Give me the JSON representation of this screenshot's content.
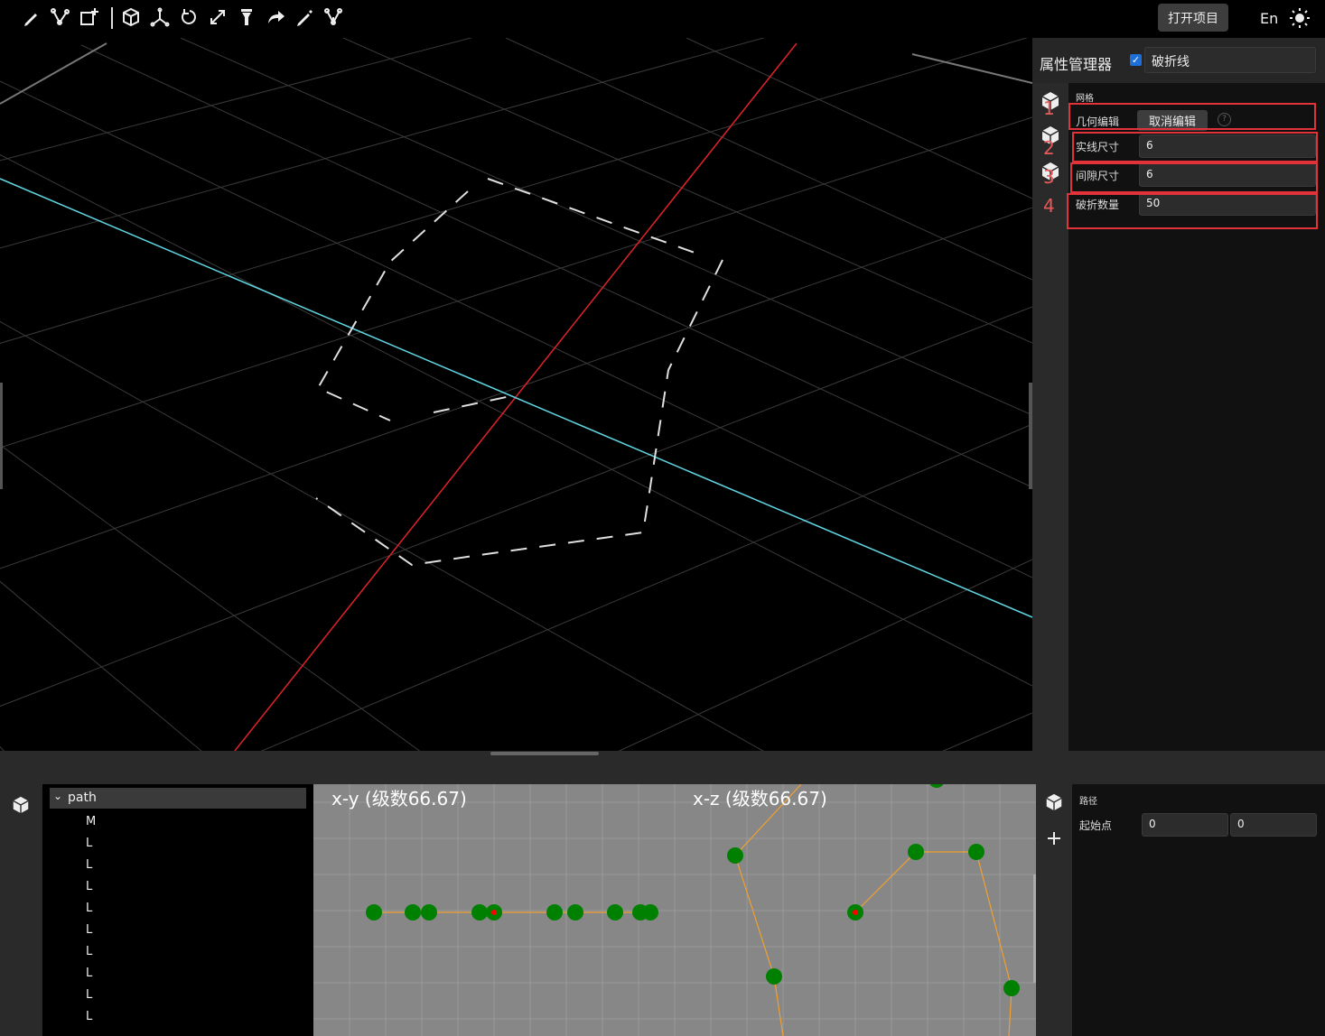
{
  "toolbar": {
    "tools": [
      "pencil-icon",
      "polyline-icon",
      "add-shape-icon",
      "cube-icon",
      "axes-icon",
      "rotate-icon",
      "scale-icon",
      "flashlight-icon",
      "redo-icon",
      "edit-icon",
      "branch-icon"
    ],
    "open_project": "打开项目",
    "language": "En",
    "theme_icon": "sun-icon"
  },
  "properties": {
    "title": "属性管理器",
    "enabled": true,
    "object_name": "破折线",
    "group": "网格",
    "geometry_edit_label": "几何编辑",
    "cancel_edit": "取消编辑",
    "help": "?",
    "dash_size_label": "实线尺寸",
    "dash_size": "6",
    "gap_size_label": "间隙尺寸",
    "gap_size": "6",
    "dash_count_label": "破折数量",
    "dash_count": "50",
    "annotations": [
      "1",
      "2",
      "3",
      "4"
    ],
    "highlight_color": "#e3333a"
  },
  "tree": {
    "root": "path",
    "items": [
      "M",
      "L",
      "L",
      "L",
      "L",
      "L",
      "L",
      "L",
      "L",
      "L"
    ]
  },
  "plots": {
    "xy_title": "x-y (级数66.67)",
    "xz_title": "x-z (级数66.67)",
    "point_color": "#008000",
    "line_color": "#f0a030",
    "active_point_color": "#ff0000"
  },
  "path_panel": {
    "title": "路径",
    "start_label": "起始点",
    "start_x": "0",
    "start_y": "0"
  },
  "colors": {
    "x_axis": "#e0222a",
    "z_axis": "#5fd4e0",
    "grid": "#3a3a3a",
    "dashed_line": "#e0e0e0"
  }
}
